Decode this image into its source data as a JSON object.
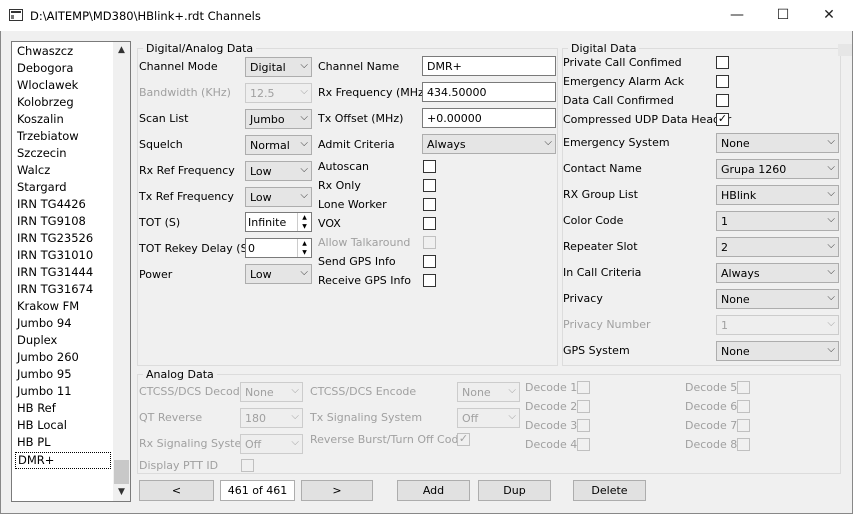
{
  "window": {
    "title": "D:\\AITEMP\\MD380\\HBlink+.rdt Channels",
    "minimize": "—",
    "maximize": "☐",
    "close": "✕"
  },
  "channel_list": {
    "items": [
      "Chwaszcz",
      "Debogora",
      "Wloclawek",
      "Kolobrzeg",
      "Koszalin",
      "Trzebiatow",
      "Szczecin",
      "Walcz",
      "Stargard",
      "IRN TG4426",
      "IRN TG9108",
      "IRN TG23526",
      "IRN TG31010",
      "IRN TG31444",
      "IRN TG31674",
      "Krakow FM",
      "Jumbo 94",
      "Duplex",
      "Jumbo 260",
      "Jumbo 95",
      "Jumbo 11",
      "HB Ref",
      "HB Local",
      "HB PL",
      "DMR+"
    ],
    "selected": "DMR+",
    "scroll_up": "▲",
    "scroll_down": "▼"
  },
  "digital_analog": {
    "title": "Digital/Analog Data",
    "channel_mode": {
      "label": "Channel Mode",
      "value": "Digital"
    },
    "bandwidth": {
      "label": "Bandwidth (KHz)",
      "value": "12.5"
    },
    "scan_list": {
      "label": "Scan List",
      "value": "Jumbo"
    },
    "squelch": {
      "label": "Squelch",
      "value": "Normal"
    },
    "rx_ref": {
      "label": "Rx Ref Frequency",
      "value": "Low"
    },
    "tx_ref": {
      "label": "Tx Ref Frequency",
      "value": "Low"
    },
    "tot": {
      "label": "TOT (S)",
      "value": "Infinite"
    },
    "tot_rekey": {
      "label": "TOT Rekey Delay (S)",
      "value": "0"
    },
    "power": {
      "label": "Power",
      "value": "Low"
    },
    "channel_name": {
      "label": "Channel Name",
      "value": "DMR+"
    },
    "rx_freq": {
      "label": "Rx Frequency (MHz)",
      "value": "434.50000"
    },
    "tx_offset": {
      "label": "Tx Offset (MHz)",
      "value": "+0.00000"
    },
    "admit": {
      "label": "Admit Criteria",
      "value": "Always"
    },
    "autoscan": {
      "label": "Autoscan",
      "checked": false
    },
    "rx_only": {
      "label": "Rx Only",
      "checked": false
    },
    "lone_worker": {
      "label": "Lone Worker",
      "checked": false
    },
    "vox": {
      "label": "VOX",
      "checked": false
    },
    "allow_talkaround": {
      "label": "Allow Talkaround",
      "checked": false
    },
    "send_gps": {
      "label": "Send GPS Info",
      "checked": false
    },
    "receive_gps": {
      "label": "Receive GPS Info",
      "checked": false
    }
  },
  "digital": {
    "title": "Digital Data",
    "private_call": {
      "label": "Private Call Confimed",
      "checked": false
    },
    "emergency_ack": {
      "label": "Emergency Alarm Ack",
      "checked": false
    },
    "data_call": {
      "label": "Data Call Confirmed",
      "checked": false
    },
    "udp_header": {
      "label": "Compressed UDP Data Header",
      "checked": true
    },
    "emergency_system": {
      "label": "Emergency System",
      "value": "None"
    },
    "contact_name": {
      "label": "Contact Name",
      "value": "Grupa 1260"
    },
    "rx_group": {
      "label": "RX Group List",
      "value": "HBlink"
    },
    "color_code": {
      "label": "Color Code",
      "value": "1"
    },
    "repeater_slot": {
      "label": "Repeater Slot",
      "value": "2"
    },
    "in_call": {
      "label": "In Call Criteria",
      "value": "Always"
    },
    "privacy": {
      "label": "Privacy",
      "value": "None"
    },
    "privacy_number": {
      "label": "Privacy Number",
      "value": "1"
    },
    "gps_system": {
      "label": "GPS System",
      "value": "None"
    }
  },
  "analog": {
    "title": "Analog Data",
    "ctcss_decode": {
      "label": "CTCSS/DCS Decode",
      "value": "None"
    },
    "ctcss_encode": {
      "label": "CTCSS/DCS Encode",
      "value": "None"
    },
    "qt_reverse": {
      "label": "QT Reverse",
      "value": "180"
    },
    "tx_signaling": {
      "label": "Tx Signaling System",
      "value": "Off"
    },
    "rx_signaling": {
      "label": "Rx Signaling System",
      "value": "Off"
    },
    "reverse_burst": {
      "label": "Reverse Burst/Turn Off Code",
      "checked": true
    },
    "display_ptt": {
      "label": "Display PTT ID",
      "checked": false
    },
    "decode1": "Decode 1",
    "decode2": "Decode 2",
    "decode3": "Decode 3",
    "decode4": "Decode 4",
    "decode5": "Decode 5",
    "decode6": "Decode 6",
    "decode7": "Decode 7",
    "decode8": "Decode 8"
  },
  "footer": {
    "prev": "<",
    "counter": "461 of 461",
    "next": ">",
    "add": "Add",
    "dup": "Dup",
    "delete": "Delete"
  }
}
